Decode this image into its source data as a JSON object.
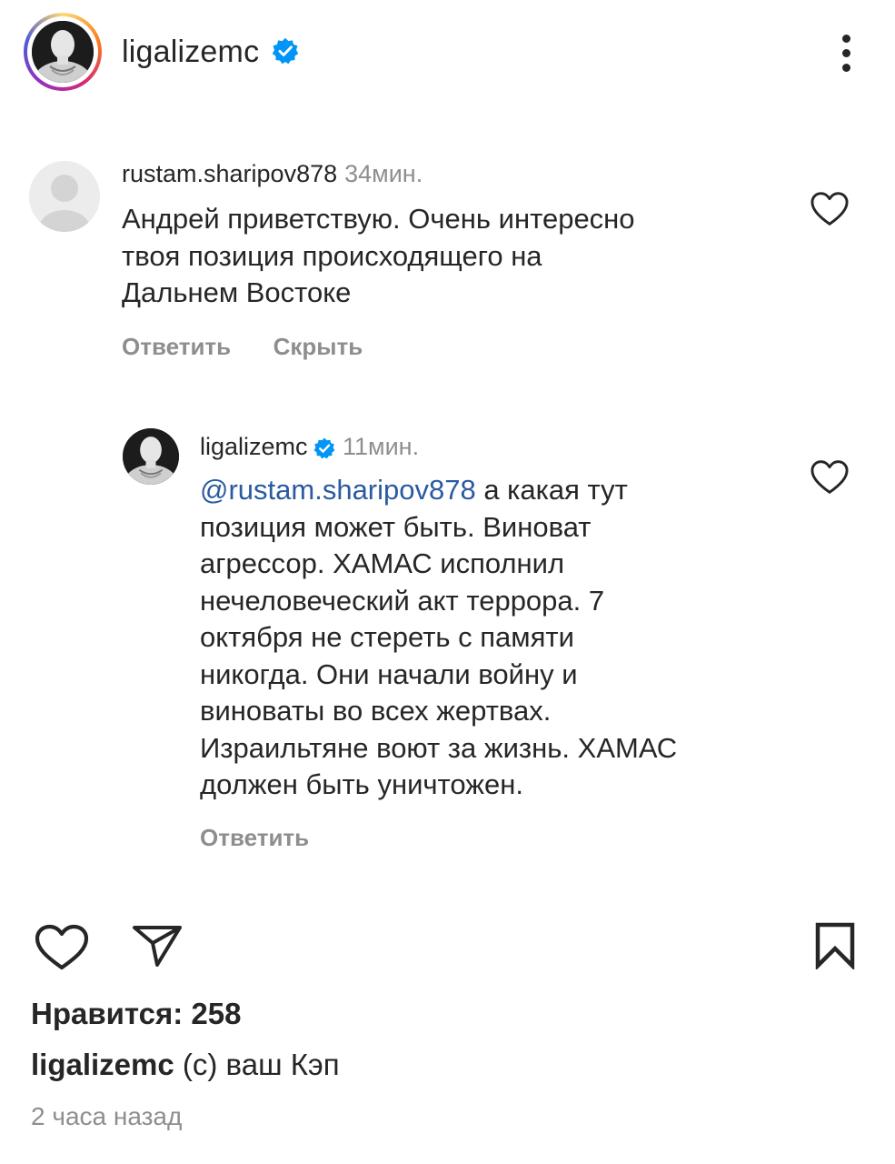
{
  "header": {
    "username": "ligalizemc",
    "verified": true,
    "more_icon": "more-vertical-icon"
  },
  "comments": [
    {
      "username": "rustam.sharipov878",
      "time": "34мин.",
      "lines": [
        "Андрей приветствую. Очень интересно",
        "твоя позиция происходящего на",
        "Дальнем Востоке"
      ],
      "reply_label": "Ответить",
      "hide_label": "Скрыть",
      "icon": "heart-outline-icon"
    }
  ],
  "reply": {
    "username": "ligalizemc",
    "verified": true,
    "time": "11мин.",
    "mention": "@rustam.sharipov878",
    "first_line_rest": " а какая тут",
    "lines": [
      "позиция может быть. Виноват",
      "агрессор. ХАМАС исполнил",
      "нечеловеческий акт террора. 7",
      "октября не стереть с памяти",
      "никогда. Они начали войну и",
      "виноваты во всех жертвах.",
      "Израильтяне воют за жизнь. ХАМАС",
      "должен быть уничтожен."
    ],
    "reply_label": "Ответить",
    "icon": "heart-outline-icon"
  },
  "actions": {
    "like_icon": "heart-outline-icon",
    "share_icon": "paper-plane-icon",
    "save_icon": "bookmark-icon"
  },
  "likes_text": "Нравится: 258",
  "caption": {
    "username": "ligalizemc",
    "text": " (с) ваш Кэп"
  },
  "post_time": "2 часа назад",
  "colors": {
    "text": "#262626",
    "secondary": "#8e8e8e",
    "verified_blue": "#0095f6",
    "mention": "#2a5aa0"
  }
}
